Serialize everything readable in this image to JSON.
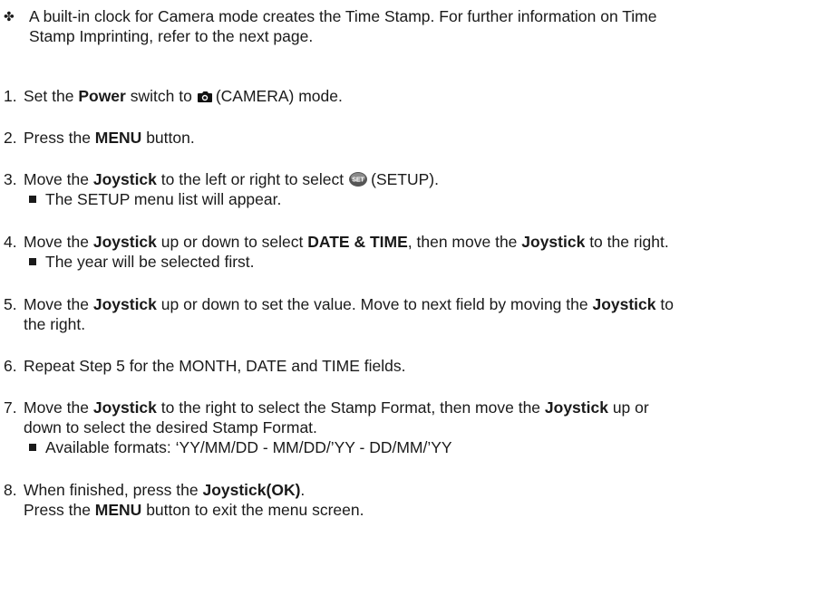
{
  "note": {
    "mark": "✤",
    "text": "A built-in clock for Camera mode creates the Time Stamp. For further information on Time\nStamp Imprinting, refer to the next page."
  },
  "steps": [
    {
      "num": "1.",
      "a": "Set the ",
      "b1": "Power",
      "c": " switch to",
      "d": "(CAMERA) mode."
    },
    {
      "num": "2.",
      "a": "Press the ",
      "b1": "MENU",
      "c": " button."
    },
    {
      "num": "3.",
      "a": "Move the ",
      "b1": "Joystick",
      "c": " to the left or right to select",
      "d": "(SETUP).",
      "sub": "The SETUP menu list will appear."
    },
    {
      "num": "4.",
      "a": "Move the ",
      "b1": "Joystick",
      "c": " up or down to select ",
      "b2": "DATE & TIME",
      "e": ", then move the ",
      "b3": "Joystick",
      "f": " to the right.",
      "sub": "The year will be selected first."
    },
    {
      "num": "5.",
      "a": "Move the ",
      "b1": "Joystick",
      "c": " up or down to set the value. Move to next field by moving the ",
      "b2": "Joystick",
      "e": " to",
      "line2": "the right."
    },
    {
      "num": "6.",
      "a": "Repeat Step 5 for the MONTH, DATE and TIME fields."
    },
    {
      "num": "7.",
      "a": "Move the ",
      "b1": "Joystick",
      "c": " to the right to select the Stamp Format, then move the ",
      "b2": "Joystick",
      "e": " up or",
      "line2": "down to select the desired Stamp Format.",
      "sub": "Available formats: ‘YY/MM/DD - MM/DD/’YY - DD/MM/’YY"
    },
    {
      "num": "8.",
      "a": "When finished, press the ",
      "b1": "Joystick(OK)",
      "c": ".",
      "line2a": "Press the ",
      "line2b": "MENU",
      "line2c": " button to exit the menu screen."
    }
  ],
  "icons": {
    "camera": "camera-icon",
    "setup": "setup-icon"
  }
}
